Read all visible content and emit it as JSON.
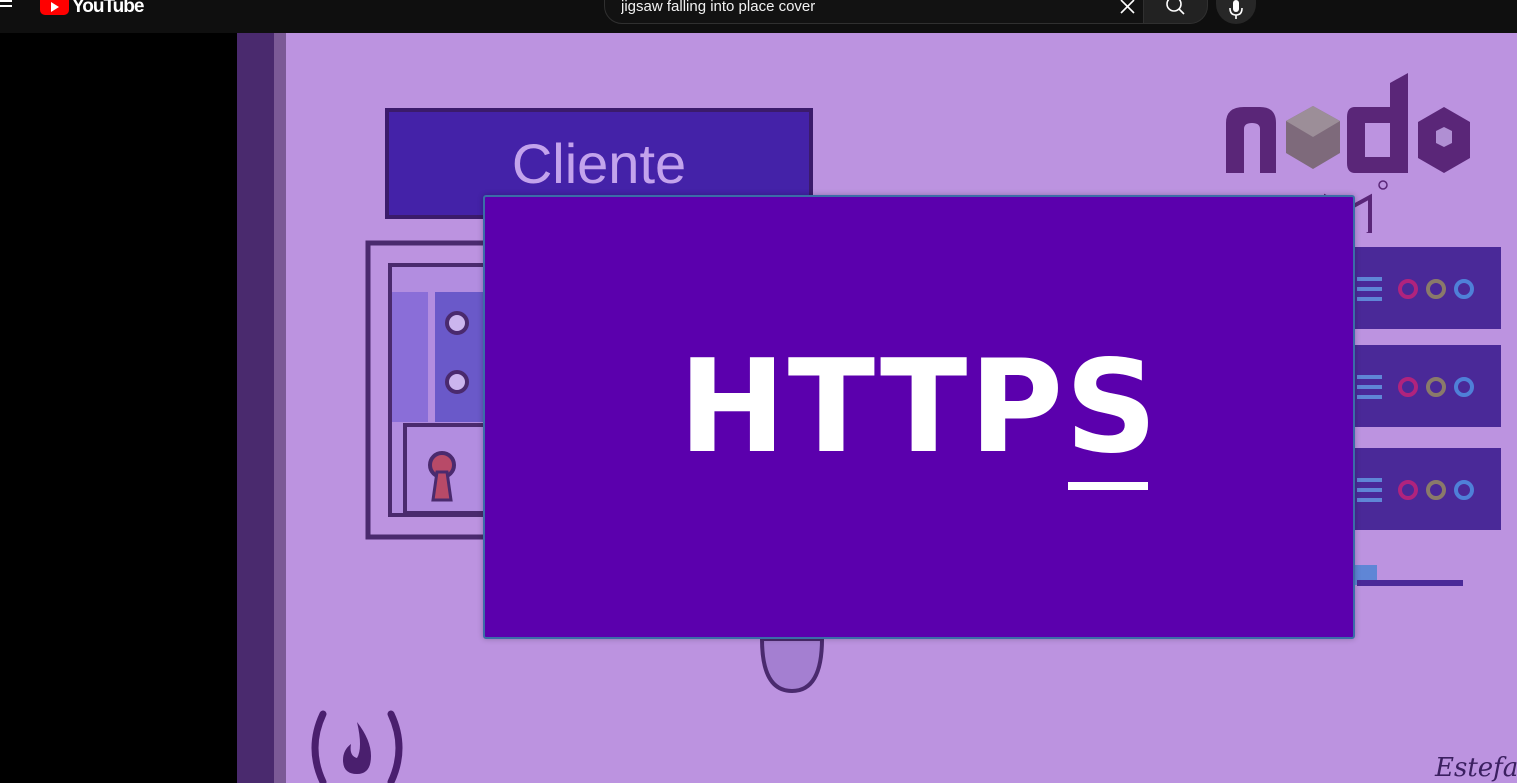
{
  "header": {
    "logo_text": "YouTube",
    "search": {
      "value": "jigsaw falling into place cover",
      "placeholder": "Search"
    }
  },
  "video": {
    "cliente_label": "Cliente",
    "https_label": "HTTPS",
    "node_logo_text": "node",
    "node_logo_sub": "JS",
    "signature": "Estefan",
    "status_dot_colors": [
      "#b0237d",
      "#8a7a6a",
      "#4f80d8"
    ],
    "accent_color": "#5b00ad",
    "background_color": "#bc93e0"
  }
}
